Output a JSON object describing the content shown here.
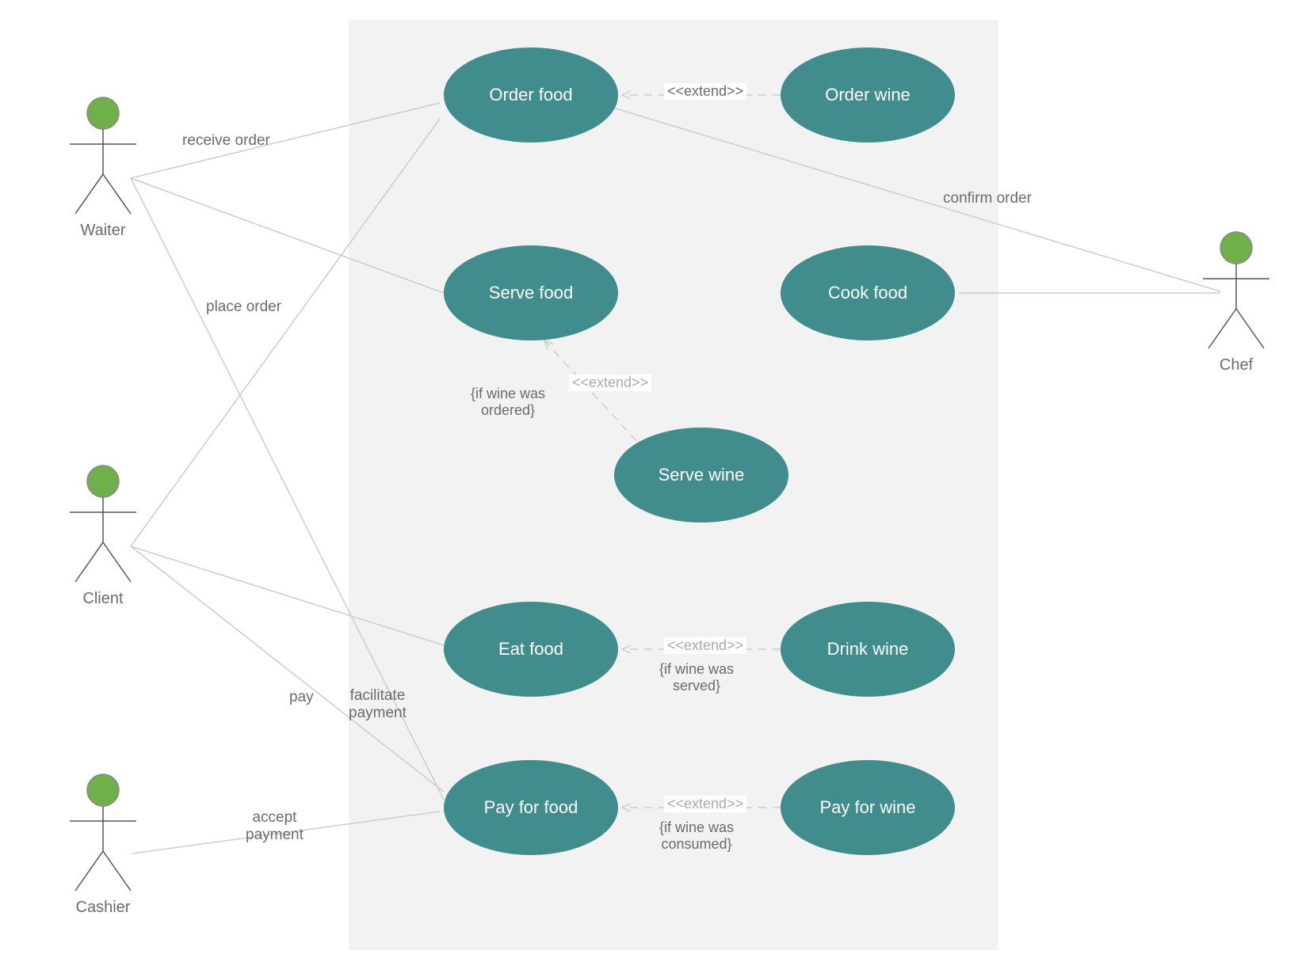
{
  "actors": {
    "waiter": "Waiter",
    "client": "Client",
    "cashier": "Cashier",
    "chef": "Chef"
  },
  "usecases": {
    "order_food": "Order food",
    "order_wine": "Order wine",
    "serve_food": "Serve food",
    "cook_food": "Cook food",
    "serve_wine": "Serve wine",
    "eat_food": "Eat food",
    "drink_wine": "Drink wine",
    "pay_for_food": "Pay for food",
    "pay_for_wine": "Pay for wine"
  },
  "assoc_labels": {
    "receive_order": "receive order",
    "place_order": "place order",
    "confirm_order": "confirm order",
    "pay": "pay",
    "facilitate_payment": "facilitate\npayment",
    "accept_payment": "accept\npayment"
  },
  "stereotypes": {
    "extend": "<<extend>>"
  },
  "guards": {
    "if_wine_ordered": "{if wine was\nordered}",
    "if_wine_served": "{if wine was\nserved}",
    "if_wine_consumed": "{if wine was\nconsumed}"
  }
}
